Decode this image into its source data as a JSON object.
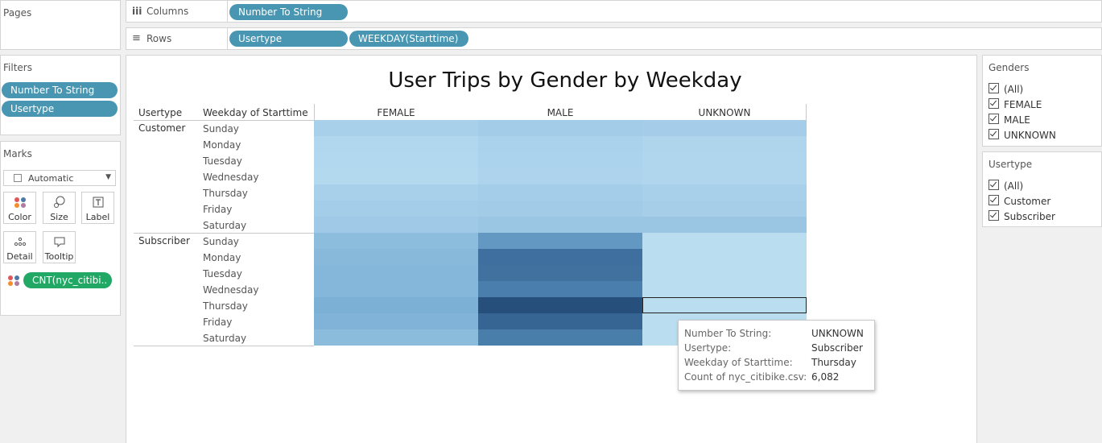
{
  "pages": {
    "title": "Pages"
  },
  "columns_shelf": {
    "label": "Columns",
    "pills": [
      "Number To String"
    ]
  },
  "rows_shelf": {
    "label": "Rows",
    "pills": [
      "Usertype",
      "WEEKDAY(Starttime)"
    ]
  },
  "filters": {
    "title": "Filters",
    "pills": [
      "Number To String",
      "Usertype"
    ]
  },
  "marks": {
    "title": "Marks",
    "type_select": "Automatic",
    "buttons": [
      "Color",
      "Size",
      "Label",
      "Detail",
      "Tooltip"
    ],
    "field_pill": "CNT(nyc_citibi.."
  },
  "view": {
    "title": "User Trips by Gender by Weekday",
    "row_header_1": "Usertype",
    "row_header_2": "Weekday of Starttime",
    "columns": [
      "FEMALE",
      "MALE",
      "UNKNOWN"
    ],
    "groups": [
      {
        "name": "Customer",
        "days": [
          "Sunday",
          "Monday",
          "Tuesday",
          "Wednesday",
          "Thursday",
          "Friday",
          "Saturday"
        ]
      },
      {
        "name": "Subscriber",
        "days": [
          "Sunday",
          "Monday",
          "Tuesday",
          "Wednesday",
          "Thursday",
          "Friday",
          "Saturday"
        ]
      }
    ]
  },
  "chart_data": {
    "type": "heatmap",
    "title": "User Trips by Gender by Weekday",
    "x_categories": [
      "FEMALE",
      "MALE",
      "UNKNOWN"
    ],
    "y_categories": [
      "Customer / Sunday",
      "Customer / Monday",
      "Customer / Tuesday",
      "Customer / Wednesday",
      "Customer / Thursday",
      "Customer / Friday",
      "Customer / Saturday",
      "Subscriber / Sunday",
      "Subscriber / Monday",
      "Subscriber / Tuesday",
      "Subscriber / Wednesday",
      "Subscriber / Thursday",
      "Subscriber / Friday",
      "Subscriber / Saturday"
    ],
    "colors": [
      [
        "#a9d0eb",
        "#a3cce8",
        "#a5cde9"
      ],
      [
        "#b1d7ee",
        "#abd2ec",
        "#afd5ed"
      ],
      [
        "#b2d8ef",
        "#acd3ed",
        "#b0d6ee"
      ],
      [
        "#b3d9ef",
        "#aed4ed",
        "#b0d6ee"
      ],
      [
        "#a9d0eb",
        "#a4cde9",
        "#a9d0ea"
      ],
      [
        "#a4cde9",
        "#a1cbe7",
        "#a6cee9"
      ],
      [
        "#9fc9e6",
        "#9ac6e4",
        "#9ac5e3"
      ],
      [
        "#8dbddd",
        "#6398c3",
        "#badef0"
      ],
      [
        "#88b9db",
        "#3e6f9f",
        "#badef0"
      ],
      [
        "#85b7da",
        "#41729f",
        "#badef0"
      ],
      [
        "#85b7da",
        "#497ead",
        "#badef0"
      ],
      [
        "#7cb0d5",
        "#264f7c",
        "#badef0"
      ],
      [
        "#80b3d7",
        "#366593",
        "#badef0"
      ],
      [
        "#8bbcdc",
        "#4a7eaa",
        "#badef0"
      ]
    ],
    "selected": {
      "row": "Subscriber / Thursday",
      "col": "UNKNOWN"
    }
  },
  "genders": {
    "title": "Genders",
    "items": [
      "(All)",
      "FEMALE",
      "MALE",
      "UNKNOWN"
    ]
  },
  "usertype_filter": {
    "title": "Usertype",
    "items": [
      "(All)",
      "Customer",
      "Subscriber"
    ]
  },
  "tooltip": {
    "rows": [
      {
        "key": "Number To String:",
        "value": "UNKNOWN"
      },
      {
        "key": "Usertype:",
        "value": "Subscriber"
      },
      {
        "key": "Weekday of Starttime:",
        "value": "Thursday"
      },
      {
        "key": "Count of nyc_citibike.csv:",
        "value": "6,082"
      }
    ]
  }
}
